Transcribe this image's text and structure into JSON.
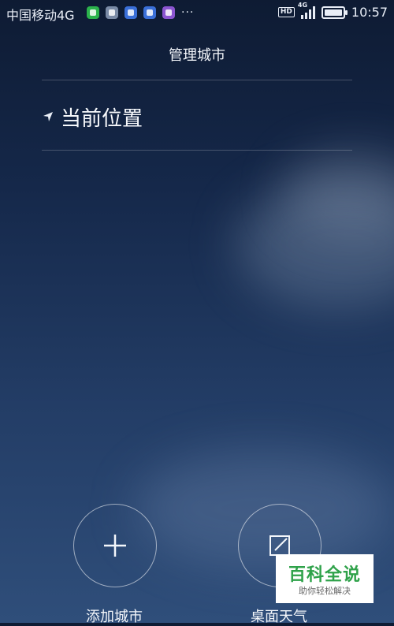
{
  "status_bar": {
    "carrier": "中国移动4G",
    "hd_badge": "HD",
    "network_tag": "4G",
    "time": "10:57",
    "notification_icons": [
      {
        "name": "wechat-icon",
        "color": "#2bb24c"
      },
      {
        "name": "gallery-icon",
        "color": "#7a8ba6"
      },
      {
        "name": "baidu-icon",
        "color": "#3a6fd8"
      },
      {
        "name": "baidu-icon",
        "color": "#3a6fd8"
      },
      {
        "name": "message-icon",
        "color": "#8b55d0"
      }
    ],
    "more": "···"
  },
  "header": {
    "title": "管理城市"
  },
  "current_location": {
    "label": "当前位置"
  },
  "actions": {
    "add_city": "添加城市",
    "desktop_weather": "桌面天气"
  },
  "watermark": {
    "title": "百科全说",
    "subtitle": "助你轻松解决"
  }
}
